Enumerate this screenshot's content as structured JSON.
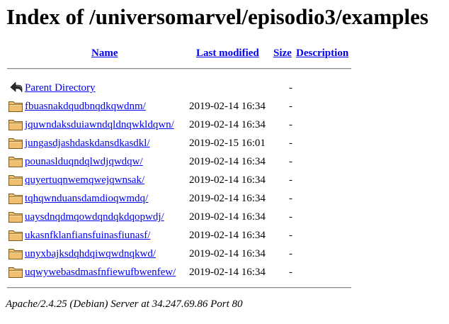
{
  "title": "Index of /universomarvel/episodio3/examples",
  "columns": {
    "name": "Name",
    "last_modified": "Last modified",
    "size": "Size",
    "description": "Description"
  },
  "parent": {
    "label": "Parent Directory",
    "size": "-",
    "icon": "back-arrow-icon"
  },
  "entries": [
    {
      "name": "fbuasnakdqudbnqdkqwdnm/",
      "modified": "2019-02-14 16:34",
      "size": "-",
      "icon": "folder-icon"
    },
    {
      "name": "jquwndaksduiawndqldnqwkldqwn/",
      "modified": "2019-02-14 16:34",
      "size": "-",
      "icon": "folder-icon"
    },
    {
      "name": "jungasdjashdaskdansdkasdkl/",
      "modified": "2019-02-15 16:01",
      "size": "-",
      "icon": "folder-icon"
    },
    {
      "name": "pounaslduqndqlwdjqwdqw/",
      "modified": "2019-02-14 16:34",
      "size": "-",
      "icon": "folder-icon"
    },
    {
      "name": "quyertuqnwemqwejqwnsak/",
      "modified": "2019-02-14 16:34",
      "size": "-",
      "icon": "folder-icon"
    },
    {
      "name": "tqhqwnduansdamdioqwmdq/",
      "modified": "2019-02-14 16:34",
      "size": "-",
      "icon": "folder-icon"
    },
    {
      "name": "uaysdnqdmqowdqndqkdqopwdj/",
      "modified": "2019-02-14 16:34",
      "size": "-",
      "icon": "folder-icon"
    },
    {
      "name": "ukasnfklanfiansfuinasfiunasf/",
      "modified": "2019-02-14 16:34",
      "size": "-",
      "icon": "folder-icon"
    },
    {
      "name": "unyxbajksdqhdqiwqwdnqkwd/",
      "modified": "2019-02-14 16:34",
      "size": "-",
      "icon": "folder-icon"
    },
    {
      "name": "uqwywebasdmasfnfiewufbwenfew/",
      "modified": "2019-02-14 16:34",
      "size": "-",
      "icon": "folder-icon"
    }
  ],
  "footer": "Apache/2.4.25 (Debian) Server at 34.247.69.86 Port 80",
  "colors": {
    "link": "#0000ee",
    "folder_fill": "#f0c070",
    "folder_outline": "#7a5a20"
  }
}
